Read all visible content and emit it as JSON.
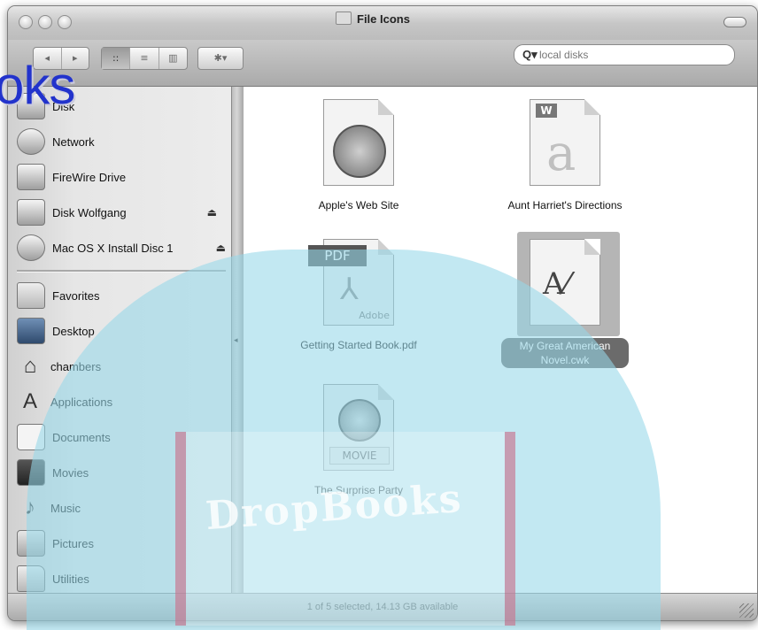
{
  "window": {
    "title": "File Icons"
  },
  "toolbar": {
    "back_forward": [
      "◂",
      "▸"
    ],
    "view_buttons": [
      "::",
      "≡",
      "▥"
    ],
    "action": "✱▾"
  },
  "search": {
    "placeholder": "local disks"
  },
  "sidebar": {
    "devices": [
      {
        "label": "Disk",
        "icon": "hard-disk-icon",
        "eject": false
      },
      {
        "label": "Network",
        "icon": "network-icon",
        "eject": false
      },
      {
        "label": "FireWire Drive",
        "icon": "firewire-drive-icon",
        "eject": false
      },
      {
        "label": "Disk Wolfgang",
        "icon": "disk-icon",
        "eject": true
      },
      {
        "label": "Mac OS X Install Disc 1",
        "icon": "cd-icon",
        "eject": true
      }
    ],
    "places": [
      {
        "label": "Favorites",
        "icon": "favorites-folder-icon"
      },
      {
        "label": "Desktop",
        "icon": "desktop-icon"
      },
      {
        "label": "chambers",
        "icon": "home-icon"
      },
      {
        "label": "Applications",
        "icon": "applications-icon"
      },
      {
        "label": "Documents",
        "icon": "documents-icon"
      },
      {
        "label": "Movies",
        "icon": "movies-icon"
      },
      {
        "label": "Music",
        "icon": "music-icon"
      },
      {
        "label": "Pictures",
        "icon": "pictures-icon"
      },
      {
        "label": "Utilities",
        "icon": "utilities-folder-icon"
      }
    ]
  },
  "files": [
    {
      "name": "Apple's Web Site",
      "icon": "safari-webloc-icon",
      "selected": false
    },
    {
      "name": "Aunt Harriet's Directions",
      "icon": "word-document-icon",
      "selected": false
    },
    {
      "name": "Getting Started Book.pdf",
      "icon": "pdf-icon",
      "badge": "PDF",
      "brand": "Adobe",
      "selected": false
    },
    {
      "name": "My Great American Novel.cwk",
      "icon": "appleworks-document-icon",
      "selected": true
    },
    {
      "name": "The Surprise Party",
      "icon": "quicktime-movie-icon",
      "badge": "MOVIE",
      "selected": false
    }
  ],
  "status": {
    "text": "1 of 5 selected, 14.13 GB available"
  },
  "watermark": {
    "text": "DropBooks",
    "corner_text": "oks"
  },
  "colors": {
    "selection": "#6b6b6b",
    "watermark": "#96d7e8"
  }
}
